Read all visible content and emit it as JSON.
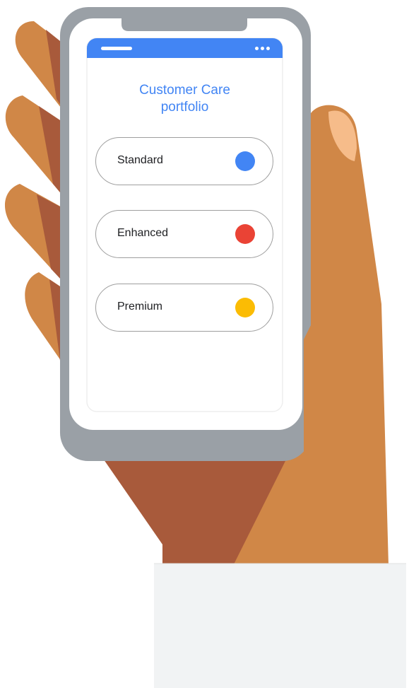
{
  "colors": {
    "accent_blue": "#4285F4",
    "red": "#EA4335",
    "yellow": "#FBBC04",
    "skin_light": "#D08747",
    "skin_dark": "#A85A3B",
    "nail": "#F6BC8A",
    "phone_frame": "#9AA0A6",
    "sleeve": "#F1F3F4"
  },
  "screen": {
    "title": "Customer Care portfolio",
    "title_line1": "Customer Care",
    "title_line2": "portfolio"
  },
  "options": [
    {
      "label": "Standard",
      "dot_color": "#4285F4",
      "dot_icon": "blue-dot-icon"
    },
    {
      "label": "Enhanced",
      "dot_color": "#EA4335",
      "dot_icon": "red-dot-icon"
    },
    {
      "label": "Premium",
      "dot_color": "#FBBC04",
      "dot_icon": "yellow-dot-icon"
    }
  ]
}
